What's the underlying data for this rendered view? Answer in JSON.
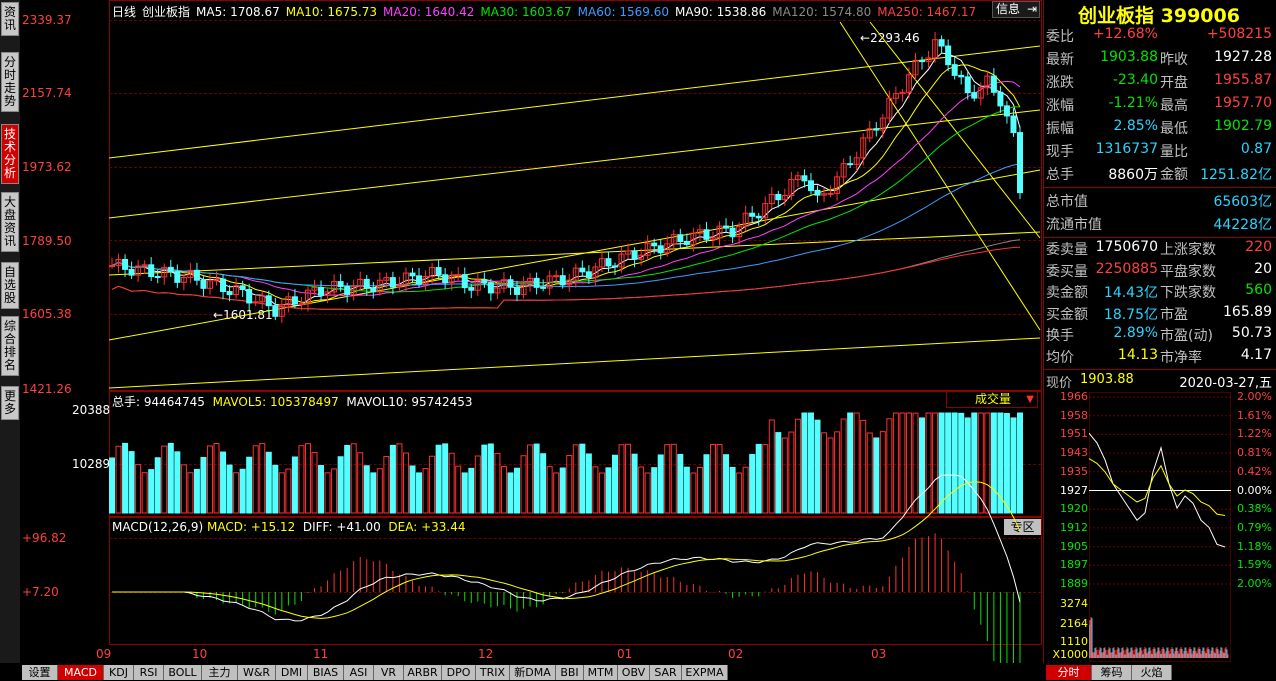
{
  "left_tabs": [
    "资讯",
    "分时走势",
    "技术分析",
    "大盘资讯",
    "自选股",
    "综合排名",
    "更多"
  ],
  "chart_header": {
    "period": "日线",
    "name": "创业板指",
    "ma5": "MA5: 1708.67",
    "ma10": "MA10: 1675.73",
    "ma20": "MA20: 1640.42",
    "ma30": "MA30: 1603.67",
    "ma60": "MA60: 1569.60",
    "ma90": "MA90: 1538.86",
    "ma120": "MA120: 1574.80",
    "ma250": "MA250: 1467.17",
    "info_btn": "信息"
  },
  "price_axis": [
    "2339.37",
    "2157.74",
    "1973.62",
    "1789.50",
    "1605.38",
    "1421.26"
  ],
  "annot_high": "2293.46",
  "annot_low": "1601.81",
  "vol_header": {
    "total": "总手: 94464745",
    "mavol5": "MAVOL5: 105378497",
    "mavol10": "MAVOL10: 95742453",
    "dropdown": "成交量"
  },
  "vol_axis": [
    "20388",
    "10289"
  ],
  "macd_header": {
    "label": "MACD(12,26,9)",
    "macd": "MACD: +15.12",
    "diff": "DIFF: +41.00",
    "dea": "DEA: +33.44",
    "zone_btn": "专区"
  },
  "macd_axis": [
    "+96.82",
    "+7.20"
  ],
  "month_labels": [
    "09",
    "10",
    "11",
    "12",
    "01",
    "02",
    "03"
  ],
  "bottom_tabs": [
    "设置",
    "MACD",
    "KDJ",
    "RSI",
    "BOLL",
    "主力",
    "W&R",
    "DMI",
    "BIAS",
    "ASI",
    "VR",
    "ARBR",
    "DPO",
    "TRIX",
    "新DMA",
    "BBI",
    "MTM",
    "OBV",
    "SAR",
    "EXPMA"
  ],
  "panel": {
    "title": "创业板指 399006",
    "rows": [
      {
        "k": "委比",
        "v": "+12.68%",
        "vc": "red",
        "k2": "",
        "v2": "+508215",
        "v2c": "red"
      },
      {
        "k": "最新",
        "v": "1903.88",
        "vc": "green",
        "k2": "昨收",
        "v2": "1927.28",
        "v2c": "white"
      },
      {
        "k": "涨跌",
        "v": "-23.40",
        "vc": "green",
        "k2": "开盘",
        "v2": "1955.87",
        "v2c": "red"
      },
      {
        "k": "涨幅",
        "v": "-1.21%",
        "vc": "green",
        "k2": "最高",
        "v2": "1957.70",
        "v2c": "red"
      },
      {
        "k": "振幅",
        "v": "2.85%",
        "vc": "cyan",
        "k2": "最低",
        "v2": "1902.79",
        "v2c": "green"
      },
      {
        "k": "现手",
        "v": "1316737",
        "vc": "cyan",
        "k2": "量比",
        "v2": "0.87",
        "v2c": "cyan"
      },
      {
        "k": "总手",
        "v": "8860万",
        "vc": "white",
        "k2": "金额",
        "v2": "1251.82亿",
        "v2c": "cyan"
      }
    ],
    "mcap_rows": [
      {
        "k": "总市值",
        "v": "65603亿"
      },
      {
        "k": "流通市值",
        "v": "44228亿"
      }
    ],
    "rows2": [
      {
        "k": "委卖量",
        "v": "1750670",
        "vc": "white",
        "k2": "上涨家数",
        "v2": "220",
        "v2c": "red"
      },
      {
        "k": "委买量",
        "v": "2250885",
        "vc": "red",
        "k2": "平盘家数",
        "v2": "20",
        "v2c": "white"
      },
      {
        "k": "卖金额",
        "v": "14.43亿",
        "vc": "cyan",
        "k2": "下跌家数",
        "v2": "560",
        "v2c": "green"
      },
      {
        "k": "买金额",
        "v": "18.75亿",
        "vc": "cyan",
        "k2": "市盈",
        "v2": "165.89",
        "v2c": "white"
      },
      {
        "k": "换手",
        "v": "2.89%",
        "vc": "cyan",
        "k2": "市盈(动)",
        "v2": "50.73",
        "v2c": "white"
      },
      {
        "k": "均价",
        "v": "14.13",
        "vc": "yellow",
        "k2": "市净率",
        "v2": "4.17",
        "v2c": "white"
      }
    ]
  },
  "mini": {
    "price_label": "现价",
    "price": "1903.88",
    "date": "2020-03-27,五",
    "left_axis": [
      "1966",
      "1958",
      "1951",
      "1943",
      "1935",
      "1927",
      "1920",
      "1912",
      "1905",
      "1897",
      "1889"
    ],
    "right_axis": [
      "2.00%",
      "1.61%",
      "1.22%",
      "0.81%",
      "0.42%",
      "0.00%",
      "0.38%",
      "0.79%",
      "1.18%",
      "1.59%",
      "2.00%"
    ],
    "vol_axis": [
      "3274",
      "2164",
      "1110",
      "X1000"
    ],
    "tabs": [
      "分时",
      "筹码",
      "火焰"
    ]
  },
  "colors": {
    "up": "#ff3030",
    "down": "#54ffff",
    "ma5": "#ffffff",
    "ma10": "#ffff00",
    "ma20": "#ff40ff",
    "ma30": "#00e600",
    "ma60": "#3c9cff",
    "ma120": "#8a8a8a",
    "ma250": "#ff3030"
  },
  "icons": [
    "expand-icon",
    "dropdown-icon"
  ]
}
